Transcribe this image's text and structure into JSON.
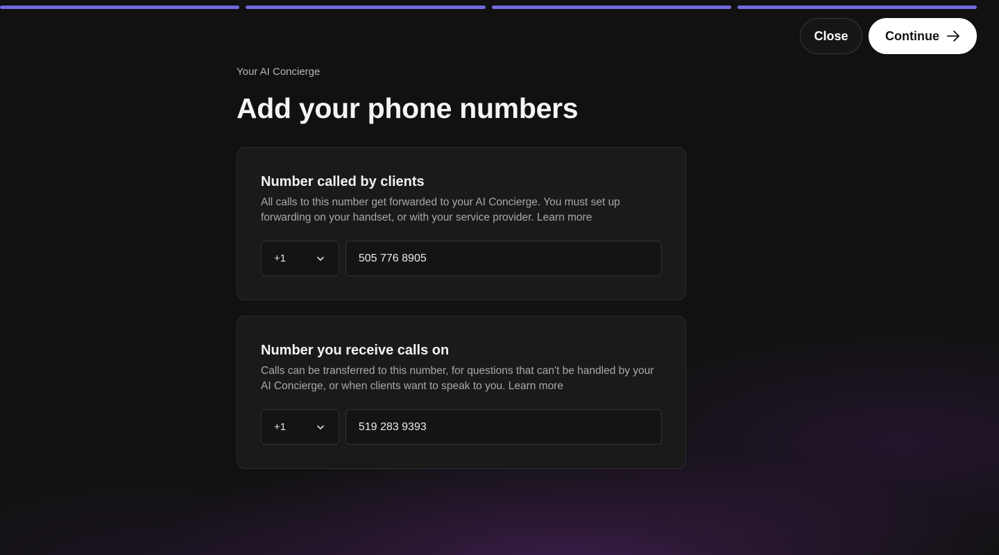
{
  "progress": {
    "segments_total": 4,
    "segments_complete": 4,
    "color": "#6f6be0"
  },
  "header": {
    "close_label": "Close",
    "continue_label": "Continue"
  },
  "page": {
    "eyebrow": "Your AI Concierge",
    "title": "Add your phone numbers"
  },
  "cards": [
    {
      "title": "Number called by clients",
      "description": "All calls to this number get forwarded to your AI Concierge. You must set up forwarding on your handset, or with your service provider.",
      "learn_more": "Learn more",
      "country_code": "+1",
      "phone_value": "505 776 8905"
    },
    {
      "title": "Number you receive calls on",
      "description": "Calls can be transferred to this number, for questions that can't be handled by your AI Concierge, or when clients want to speak to you.",
      "learn_more": "Learn more",
      "country_code": "+1",
      "phone_value": "519 283 9393"
    }
  ],
  "icons": {
    "continue": "arrow-right-icon",
    "select": "chevron-down-icon"
  },
  "colors": {
    "background": "#111111",
    "card": "#1a1a1a",
    "accent": "#6f6be0",
    "glow": "#5c2678"
  }
}
